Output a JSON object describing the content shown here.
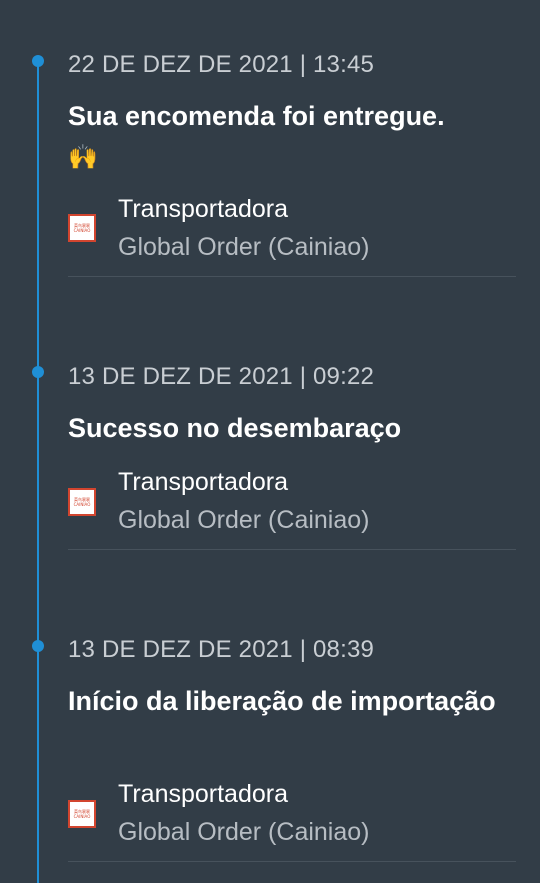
{
  "timeline": {
    "events": [
      {
        "date": "22 DE DEZ DE 2021 | 13:45",
        "title": "Sua encomenda foi entregue.",
        "title_emoji": "🙌",
        "carrier_label": "Transportadora",
        "carrier_name": "Global Order (Cainiao)",
        "carrier_logo_text": [
          "菜鸟裹裹",
          "CAINIAO"
        ]
      },
      {
        "date": "13 DE DEZ DE 2021 | 09:22",
        "title": "Sucesso no desembaraço",
        "carrier_label": "Transportadora",
        "carrier_name": "Global Order (Cainiao)",
        "carrier_logo_text": [
          "菜鸟裹裹",
          "CAINIAO"
        ]
      },
      {
        "date": "13 DE DEZ DE 2021 | 08:39",
        "title": "Início da liberação de importação",
        "carrier_label": "Transportadora",
        "carrier_name": "Global Order (Cainiao)",
        "carrier_logo_text": [
          "菜鸟裹裹",
          "CAINIAO"
        ]
      }
    ]
  },
  "colors": {
    "background": "#323d47",
    "timeline_accent": "#1f8fd6",
    "date_text": "#c9ced3",
    "carrier_name_text": "#b7bdc3",
    "logo_red": "#d2452f"
  },
  "icons": {
    "carrier_logo": "cainiao-logo-icon",
    "timeline_dot": "timeline-dot-icon"
  }
}
